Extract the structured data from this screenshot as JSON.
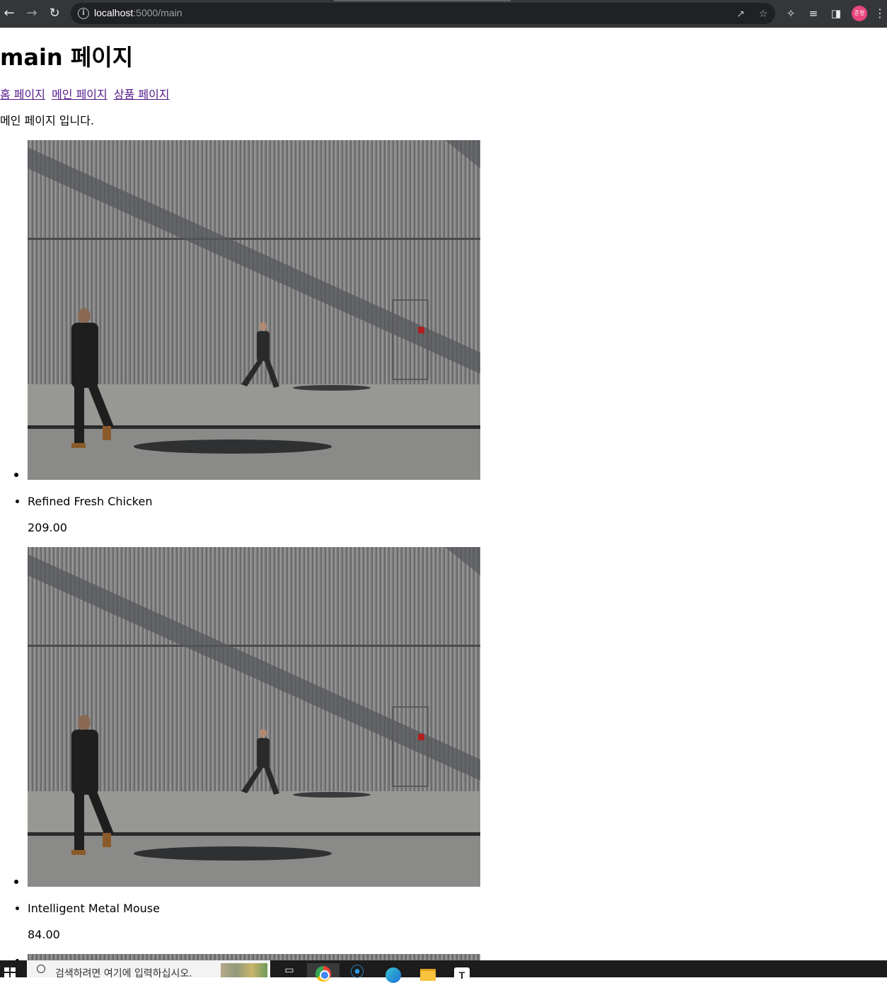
{
  "browser": {
    "url_host": "localhost",
    "url_rest": ":5000/main",
    "profile_initial": "준형"
  },
  "page": {
    "title": "main 페이지",
    "nav_links": [
      "홈 페이지",
      "메인 페이지",
      "상품 페이지"
    ],
    "intro": "메인 페이지 입니다."
  },
  "products": [
    {
      "name": "Refined Fresh Chicken",
      "price": "209.00"
    },
    {
      "name": "Intelligent Metal Mouse",
      "price": "84.00"
    }
  ],
  "taskbar": {
    "search_placeholder": "검색하려면 여기에 입력하십시오."
  },
  "colors": {
    "link_visited": "#551a8b",
    "chrome_bg": "#35363a",
    "avatar": "#e8467c"
  }
}
